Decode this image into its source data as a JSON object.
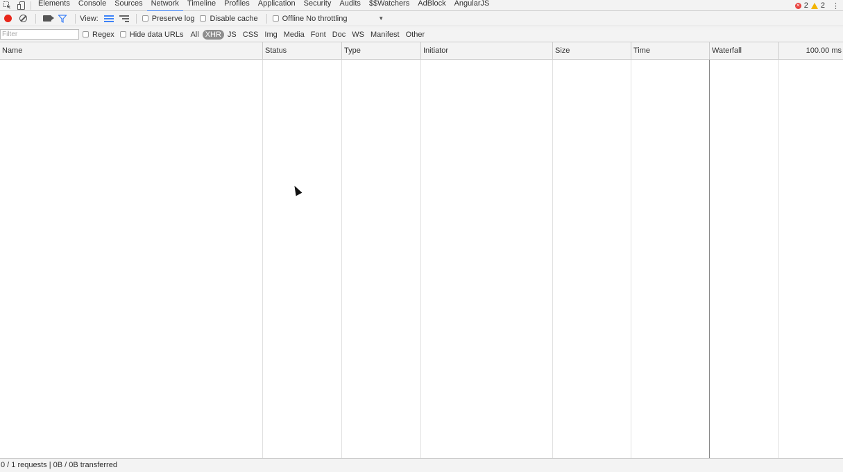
{
  "tabbar": {
    "tabs": [
      "Elements",
      "Console",
      "Sources",
      "Network",
      "Timeline",
      "Profiles",
      "Application",
      "Security",
      "Audits",
      "$$Watchers",
      "AdBlock",
      "AngularJS"
    ],
    "active": "Network",
    "errors": "2",
    "warnings": "2"
  },
  "toolbar": {
    "view_label": "View:",
    "preserve_log": "Preserve log",
    "disable_cache": "Disable cache",
    "offline": "Offline",
    "throttling": "No throttling"
  },
  "filterbar": {
    "placeholder": "Filter",
    "regex": "Regex",
    "hide_data_urls": "Hide data URLs",
    "types": [
      "All",
      "XHR",
      "JS",
      "CSS",
      "Img",
      "Media",
      "Font",
      "Doc",
      "WS",
      "Manifest",
      "Other"
    ],
    "selected_type": "XHR"
  },
  "table": {
    "columns": [
      "Name",
      "Status",
      "Type",
      "Initiator",
      "Size",
      "Time",
      "Waterfall"
    ],
    "waterfall_time": "100.00 ms"
  },
  "status": {
    "summary": "0 / 1 requests | 0B / 0B transferred"
  },
  "icons": {
    "inspect": "inspect-element-icon",
    "device": "device-mode-icon",
    "record": "record-icon",
    "clear": "clear-icon",
    "capture": "capture-screenshots-icon",
    "filter": "filter-icon",
    "list_view": "large-rows-icon",
    "overview": "overview-icon",
    "error": "error-icon",
    "warning": "warning-icon",
    "more": "more-vertical-icon"
  },
  "colors": {
    "accent": "#3e82f7",
    "record": "#e8261a",
    "error": "#e8413d",
    "warning": "#f2b400"
  }
}
